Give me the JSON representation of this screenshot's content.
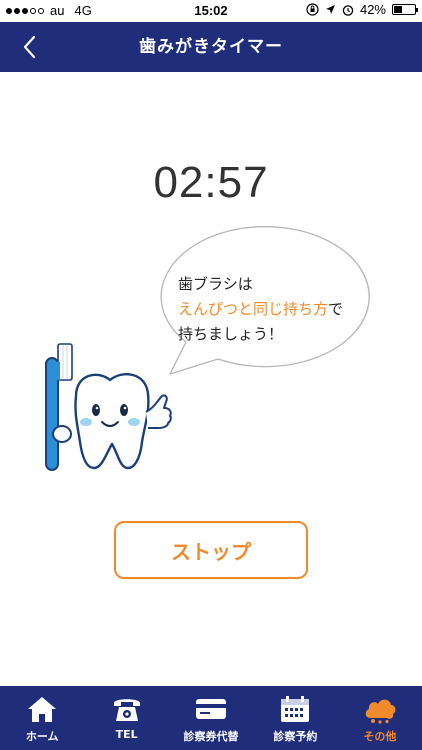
{
  "status_bar": {
    "carrier": "au",
    "network": "4G",
    "time": "15:02",
    "battery": "42%",
    "battery_level": 0.42,
    "signal_bars": 3
  },
  "nav": {
    "title": "歯みがきタイマー",
    "back_icon": "chevron-left-icon"
  },
  "timer": {
    "remaining": "02:57"
  },
  "bubble": {
    "line1": "歯ブラシは",
    "line2_highlight": "えんぴつと同じ持ち方",
    "line2_suffix": "で",
    "line3": "持ちましょう！"
  },
  "mascot": {
    "icon": "tooth-mascot-with-toothbrush"
  },
  "stop_button": {
    "label": "ストップ"
  },
  "tab_bar": {
    "items": [
      {
        "label": "ホーム",
        "icon": "house-icon"
      },
      {
        "label": "TEL",
        "icon": "telephone-icon"
      },
      {
        "label": "診察券代替",
        "icon": "card-icon"
      },
      {
        "label": "診察予約",
        "icon": "calendar-icon"
      },
      {
        "label": "その他",
        "icon": "cloud-icon",
        "active": true
      }
    ]
  },
  "colors": {
    "primary_navy": "#1f2d7a",
    "accent_orange": "#f08a2b",
    "mascot_blue": "#2a8fd6"
  }
}
